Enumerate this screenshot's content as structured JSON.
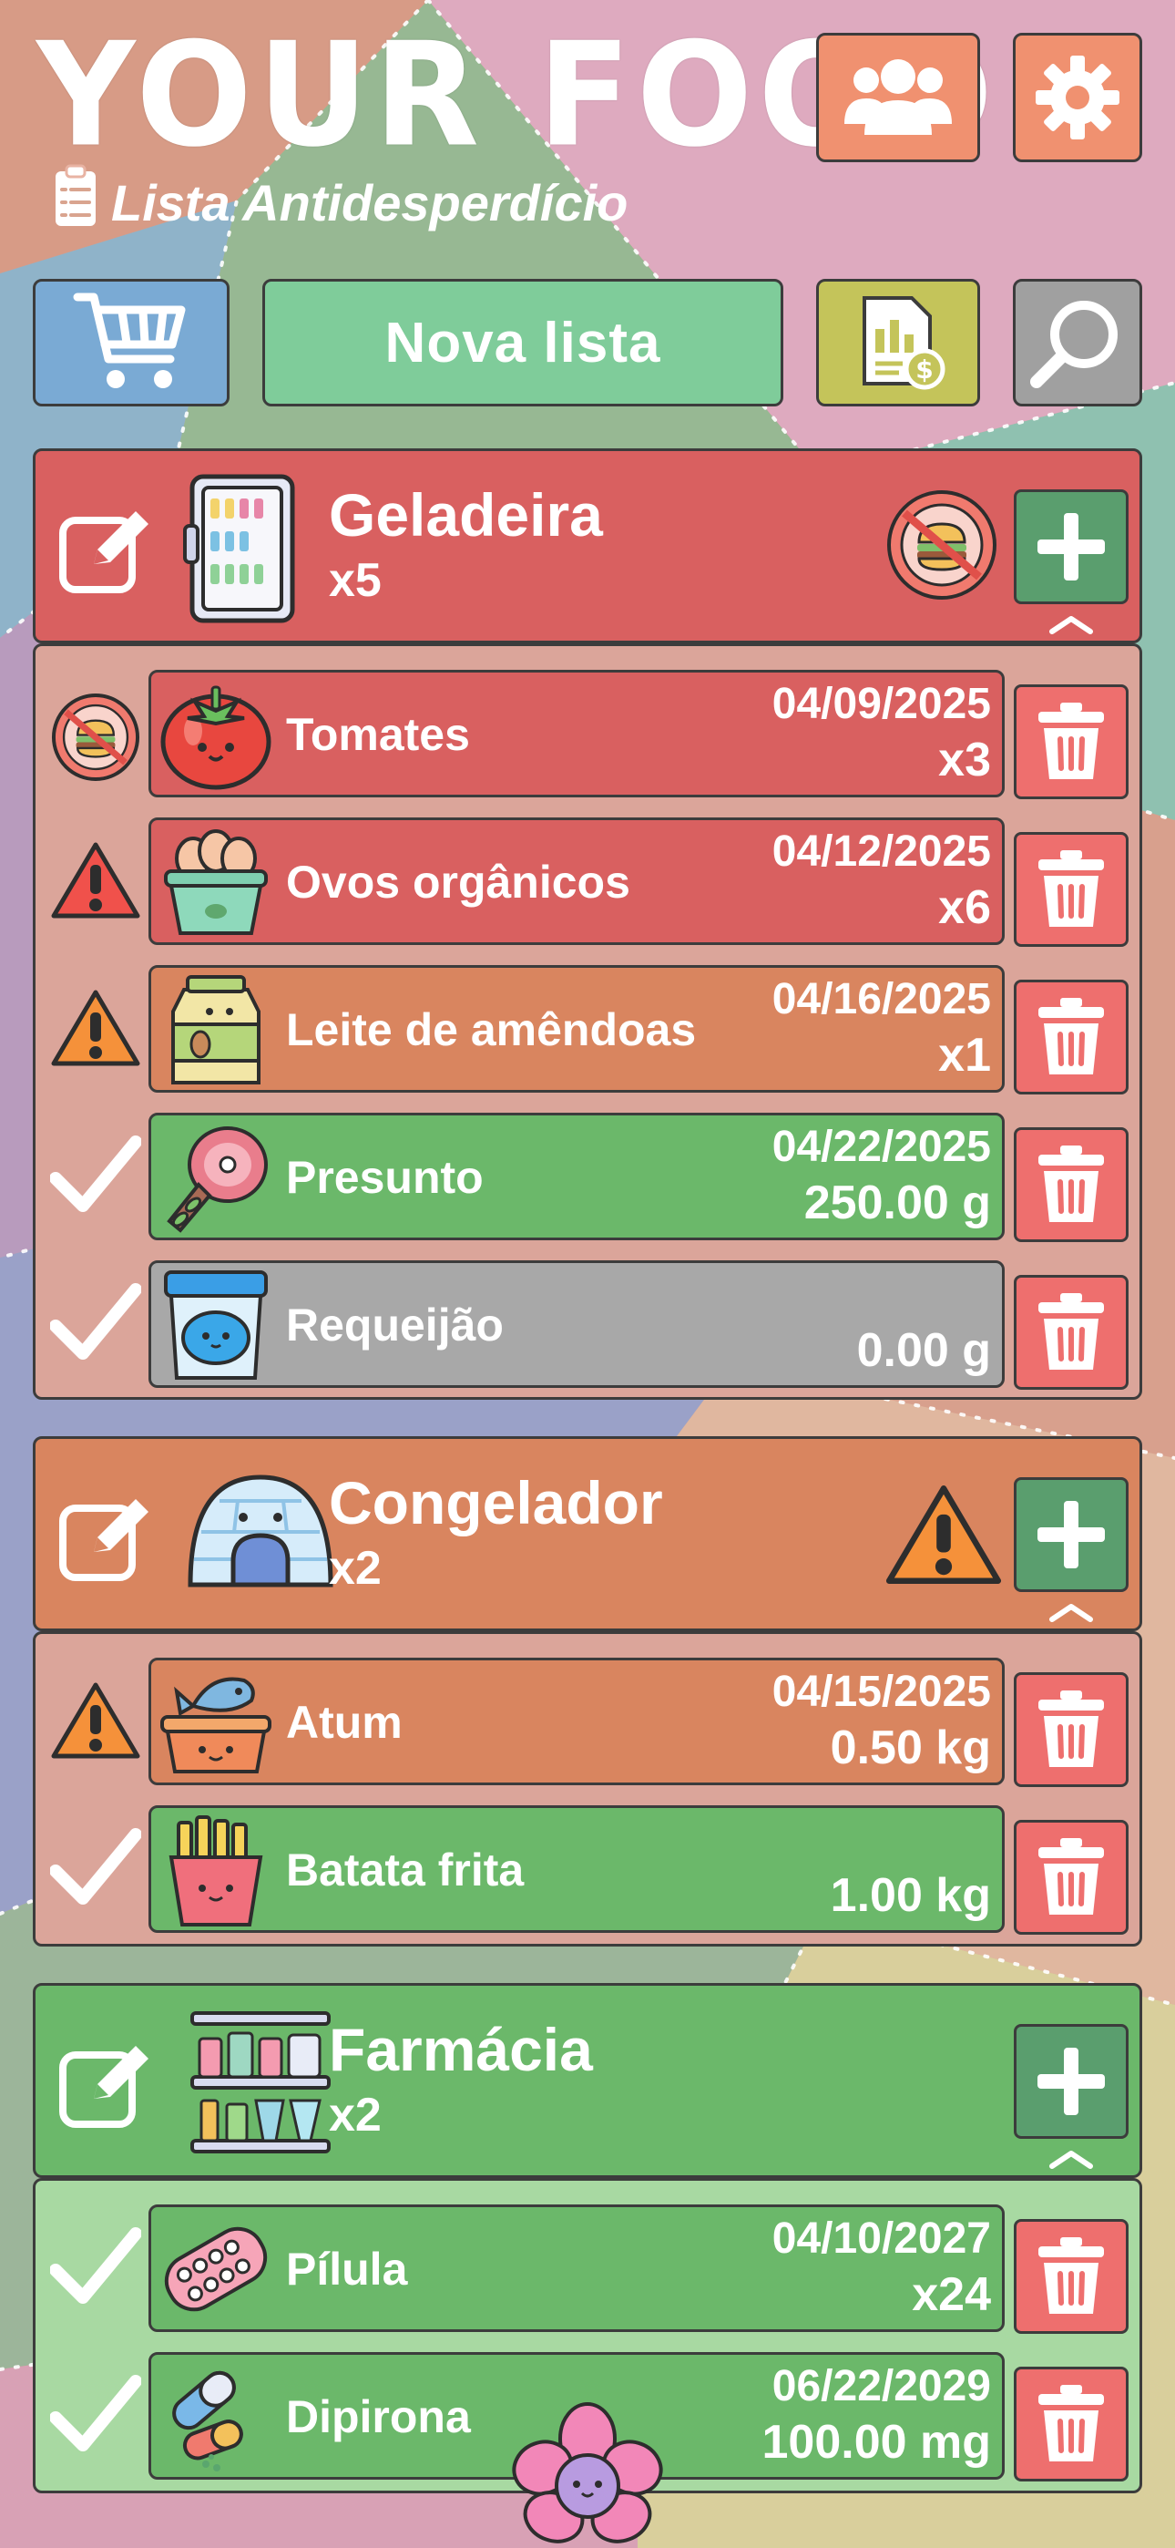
{
  "app": {
    "title": "YOUR FOOD",
    "subtitle": "Lista Antidesperdício"
  },
  "toolbar": {
    "new_list_label": "Nova lista"
  },
  "icons": {
    "users": "users-icon",
    "settings": "gear-icon",
    "cart": "shopping-cart-icon",
    "report": "report-money-icon",
    "search": "search-icon",
    "edit": "edit-icon",
    "add": "plus-icon",
    "delete": "trash-icon",
    "ok": "checkmark-icon",
    "warning": "warning-icon",
    "expired": "no-food-icon",
    "collapse": "chevron-up-icon"
  },
  "colors": {
    "red": "#d96060",
    "orange": "#d9855f",
    "green": "#6bb86a",
    "gray": "#a8a8a8",
    "accent_green": "#5a9e6e",
    "trash": "#ee6f6e"
  },
  "sections": [
    {
      "name": "Geladeira",
      "count": "x5",
      "status": "expired",
      "items": [
        {
          "name": "Tomates",
          "date": "04/09/2025",
          "qty": "x3",
          "status": "expired"
        },
        {
          "name": "Ovos orgânicos",
          "date": "04/12/2025",
          "qty": "x6",
          "status": "warning-red"
        },
        {
          "name": "Leite de amêndoas",
          "date": "04/16/2025",
          "qty": "x1",
          "status": "warning"
        },
        {
          "name": "Presunto",
          "date": "04/22/2025",
          "qty": "250.00 g",
          "status": "ok"
        },
        {
          "name": "Requeijão",
          "date": "",
          "qty": "0.00 g",
          "status": "ok-empty"
        }
      ]
    },
    {
      "name": "Congelador",
      "count": "x2",
      "status": "warning",
      "items": [
        {
          "name": "Atum",
          "date": "04/15/2025",
          "qty": "0.50 kg",
          "status": "warning"
        },
        {
          "name": "Batata frita",
          "date": "",
          "qty": "1.00 kg",
          "status": "ok"
        }
      ]
    },
    {
      "name": "Farmácia",
      "count": "x2",
      "status": "ok",
      "items": [
        {
          "name": "Pílula",
          "date": "04/10/2027",
          "qty": "x24",
          "status": "ok"
        },
        {
          "name": "Dipirona",
          "date": "06/22/2029",
          "qty": "100.00 mg",
          "status": "ok"
        }
      ]
    }
  ]
}
